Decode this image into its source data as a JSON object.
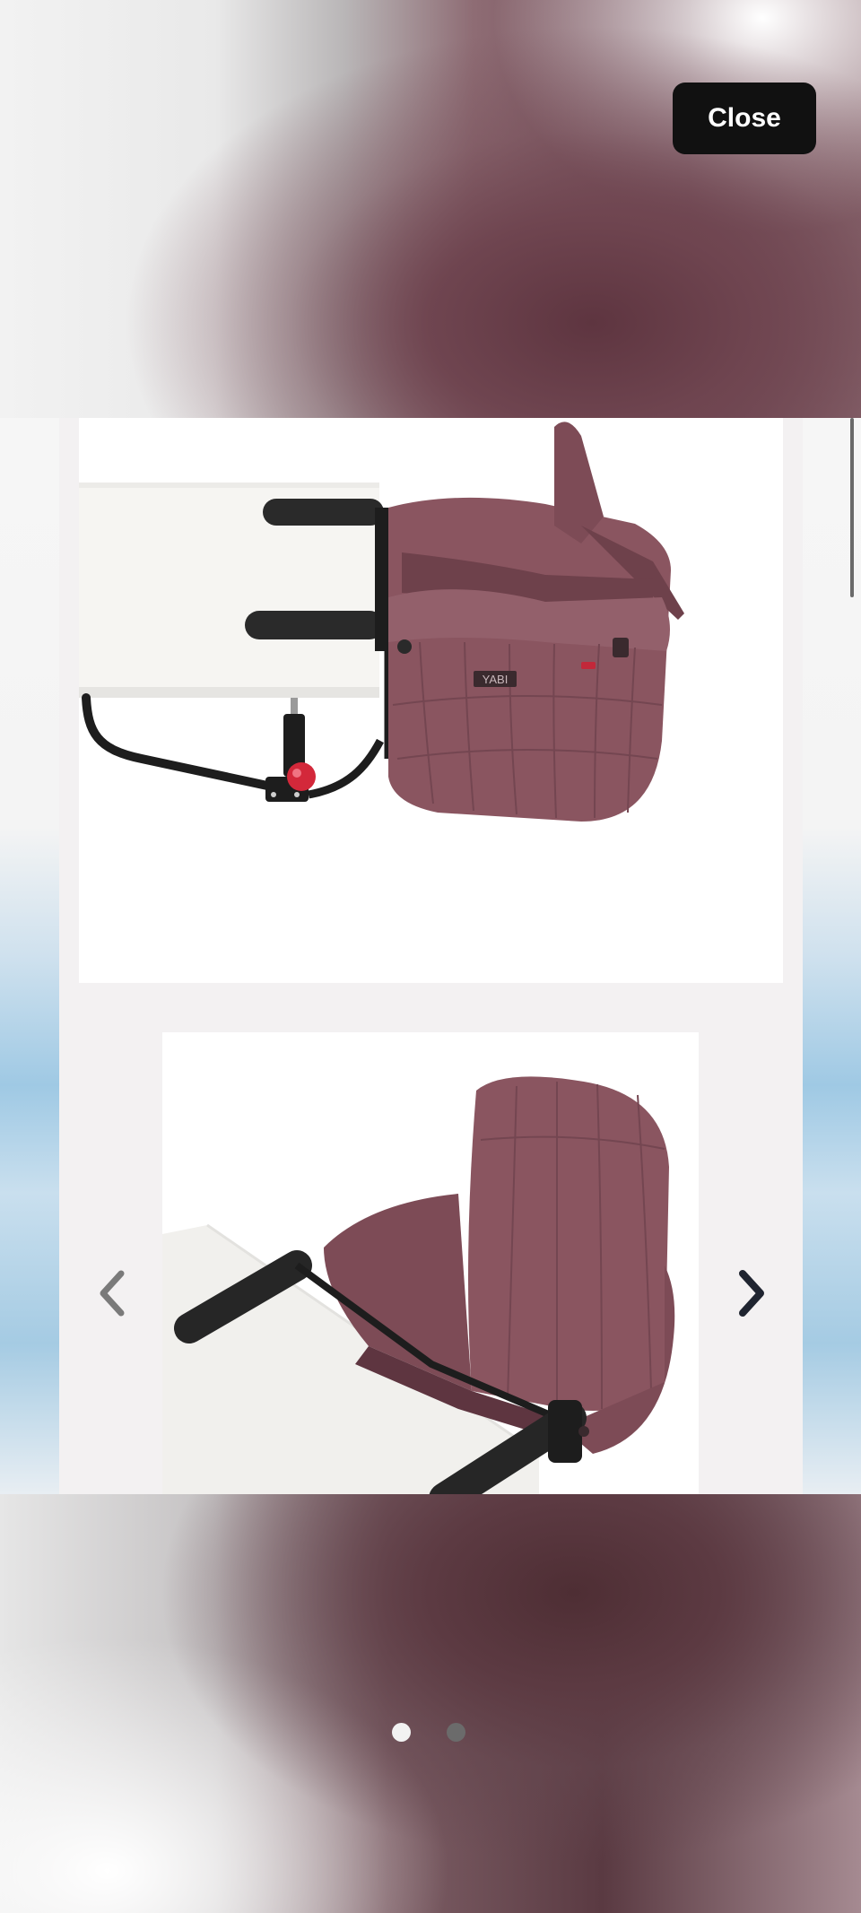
{
  "close_button": {
    "label": "Close"
  },
  "gallery": {
    "slides": [
      {
        "name": "table-chair-side-view",
        "brand_label": "YABI"
      },
      {
        "name": "table-chair-front-view"
      }
    ],
    "prev_icon": "chevron-left-icon",
    "next_icon": "chevron-right-icon"
  },
  "pagination": {
    "count": 2,
    "active_index": 0
  },
  "colors": {
    "fabric": "#8a5560",
    "fabric_dark": "#6e414b",
    "frame": "#1d1d1d",
    "button_red": "#d3283a",
    "close_bg": "#111111"
  }
}
